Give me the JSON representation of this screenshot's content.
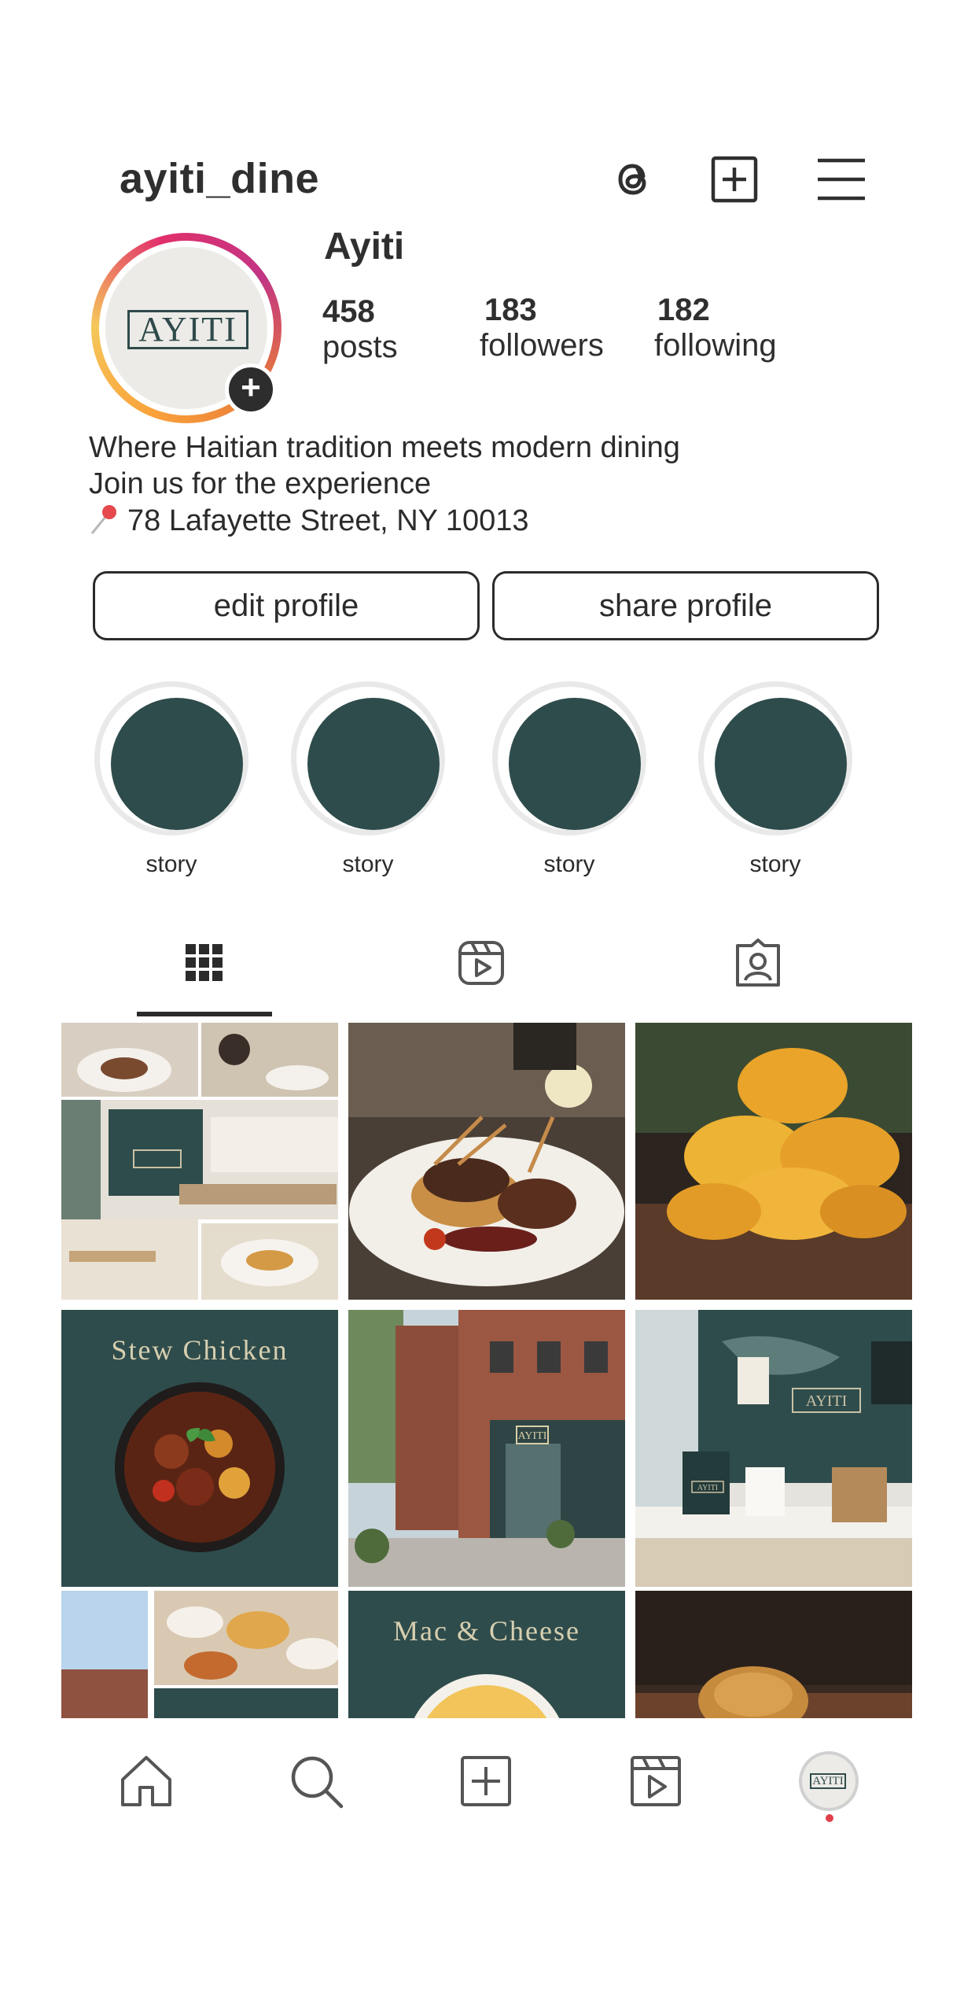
{
  "header": {
    "username": "ayiti_dine",
    "icons": [
      "threads-icon",
      "new-post-icon",
      "menu-icon"
    ]
  },
  "profile": {
    "display_name": "Ayiti",
    "avatar_logo_text": "AYITI",
    "stats": [
      {
        "value": "458",
        "label": "posts"
      },
      {
        "value": "183",
        "label": "followers"
      },
      {
        "value": "182",
        "label": "following"
      }
    ],
    "bio": [
      "Where Haitian tradition meets modern dining",
      "Join us for the experience",
      "78 Lafayette Street, NY 10013"
    ],
    "location_icon": "pin-icon"
  },
  "buttons": {
    "edit": "edit profile",
    "share": "share profile"
  },
  "highlights": [
    {
      "label": "story"
    },
    {
      "label": "story"
    },
    {
      "label": "story"
    },
    {
      "label": "story"
    }
  ],
  "tabs": [
    {
      "icon": "grid-icon",
      "active": true
    },
    {
      "icon": "reels-icon",
      "active": false
    },
    {
      "icon": "tagged-icon",
      "active": false
    }
  ],
  "posts": [
    {
      "caption": ""
    },
    {
      "caption": ""
    },
    {
      "caption": ""
    },
    {
      "caption": "Stew Chicken"
    },
    {
      "caption": ""
    },
    {
      "caption": ""
    },
    {
      "caption": ""
    },
    {
      "caption": "Mac & Cheese"
    },
    {
      "caption": ""
    }
  ],
  "post_signage": {
    "storefront": "AYITI",
    "interior": "AYITI",
    "bag": "AYITI"
  },
  "bottom_nav": {
    "items": [
      "home-icon",
      "search-icon",
      "create-icon",
      "reels-icon",
      "profile-icon"
    ],
    "profile_logo": "AYITI",
    "notification_color": "#e0404a"
  },
  "colors": {
    "brand_green": "#2f4c4c",
    "text": "#2b2b2b"
  }
}
